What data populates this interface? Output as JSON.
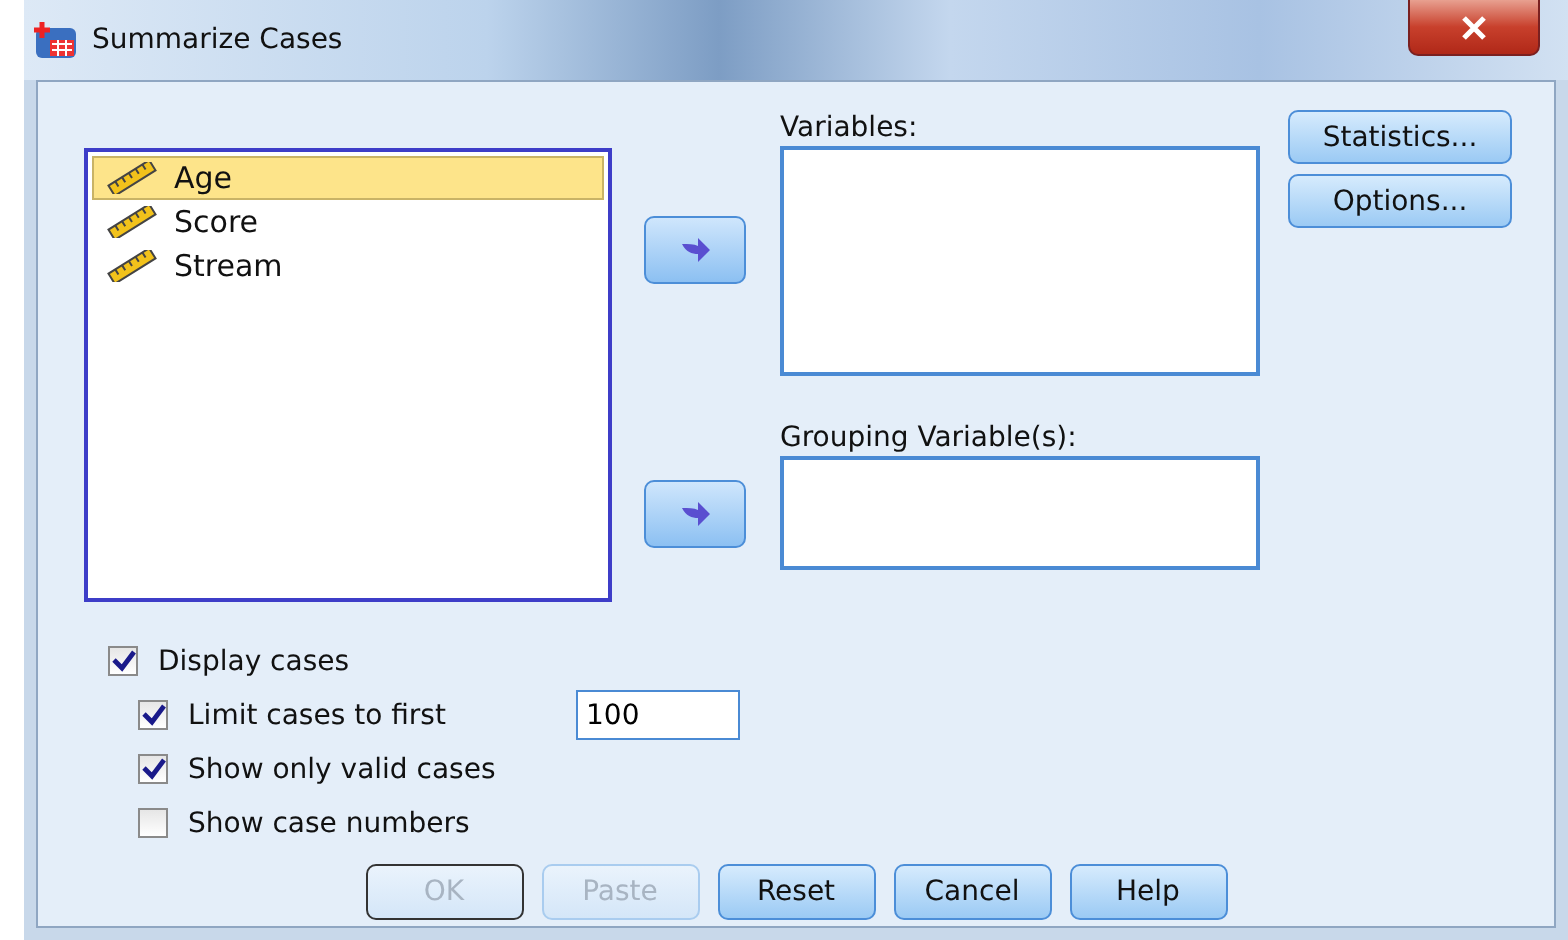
{
  "window": {
    "title": "Summarize Cases"
  },
  "source_list": {
    "items": [
      {
        "label": "Age",
        "selected": true
      },
      {
        "label": "Score",
        "selected": false
      },
      {
        "label": "Stream",
        "selected": false
      }
    ]
  },
  "targets": [
    {
      "label": "Variables:",
      "kind": "tall"
    },
    {
      "label": "Grouping Variable(s):",
      "kind": "short"
    }
  ],
  "side_buttons": [
    {
      "label": "Statistics..."
    },
    {
      "label": "Options..."
    }
  ],
  "options": [
    {
      "label": "Display cases",
      "checked": true,
      "indented": false
    },
    {
      "label": "Limit cases to first",
      "checked": true,
      "indented": true,
      "value": "100"
    },
    {
      "label": "Show only valid cases",
      "checked": true,
      "indented": true
    },
    {
      "label": "Show case numbers",
      "checked": false,
      "indented": true
    }
  ],
  "buttons": [
    {
      "label": "OK",
      "disabled": true,
      "default": true
    },
    {
      "label": "Paste",
      "disabled": true,
      "default": false
    },
    {
      "label": "Reset",
      "disabled": false,
      "default": false
    },
    {
      "label": "Cancel",
      "disabled": false,
      "default": false
    },
    {
      "label": "Help",
      "disabled": false,
      "default": false
    }
  ]
}
